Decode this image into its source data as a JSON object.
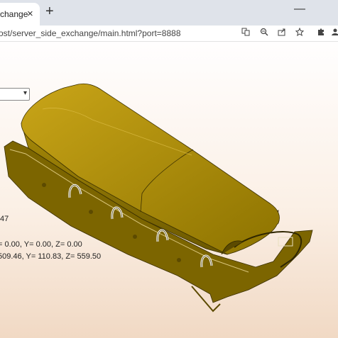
{
  "tab": {
    "title": "change",
    "close": "×"
  },
  "new_tab": "+",
  "window": {
    "minimize": "—"
  },
  "address_bar": {
    "url": "ost/server_side_exchange/main.html?port=8888"
  },
  "toolbar_icons": [
    "translate-icon",
    "zoom-icon",
    "share-icon",
    "star-icon",
    "extensions-icon",
    "profile-icon"
  ],
  "viewer": {
    "select_value": "",
    "info": {
      "line1": ".47",
      "line2": "= 0.00, Y= 0.00, Z= 0.00",
      "line3": "509.46, Y= 110.83, Z= 559.50"
    }
  },
  "colors": {
    "model": "#b8960e",
    "model_dark": "#6b5800",
    "background_top": "#fffefe",
    "background_bottom": "#f1d9c4"
  }
}
